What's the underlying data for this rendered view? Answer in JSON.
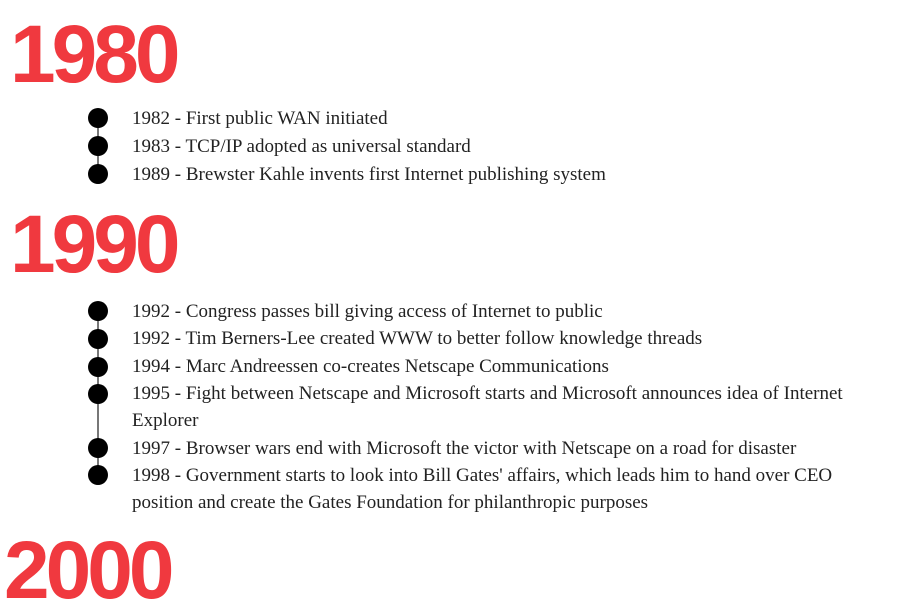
{
  "sections": [
    {
      "decade": "1980",
      "events": [
        "1982 - First public WAN initiated",
        "1983 - TCP/IP adopted as universal standard",
        "1989 - Brewster Kahle invents first Internet publishing system"
      ]
    },
    {
      "decade": "1990",
      "events": [
        "1992 - Congress passes bill giving access of Internet to public",
        "1992 - Tim Berners-Lee created WWW to better follow knowledge threads",
        "1994 - Marc Andreessen co-creates Netscape Communications",
        "1995 - Fight between Netscape and Microsoft starts and Microsoft announces idea of Internet Explorer",
        "1997 - Browser wars end with Microsoft the victor with Netscape on a road for disaster",
        "1998 - Government starts to look into Bill Gates' affairs, which leads him to hand over CEO position and create the Gates Foundation for philanthropic purposes"
      ]
    },
    {
      "decade": "2000",
      "events": []
    }
  ]
}
